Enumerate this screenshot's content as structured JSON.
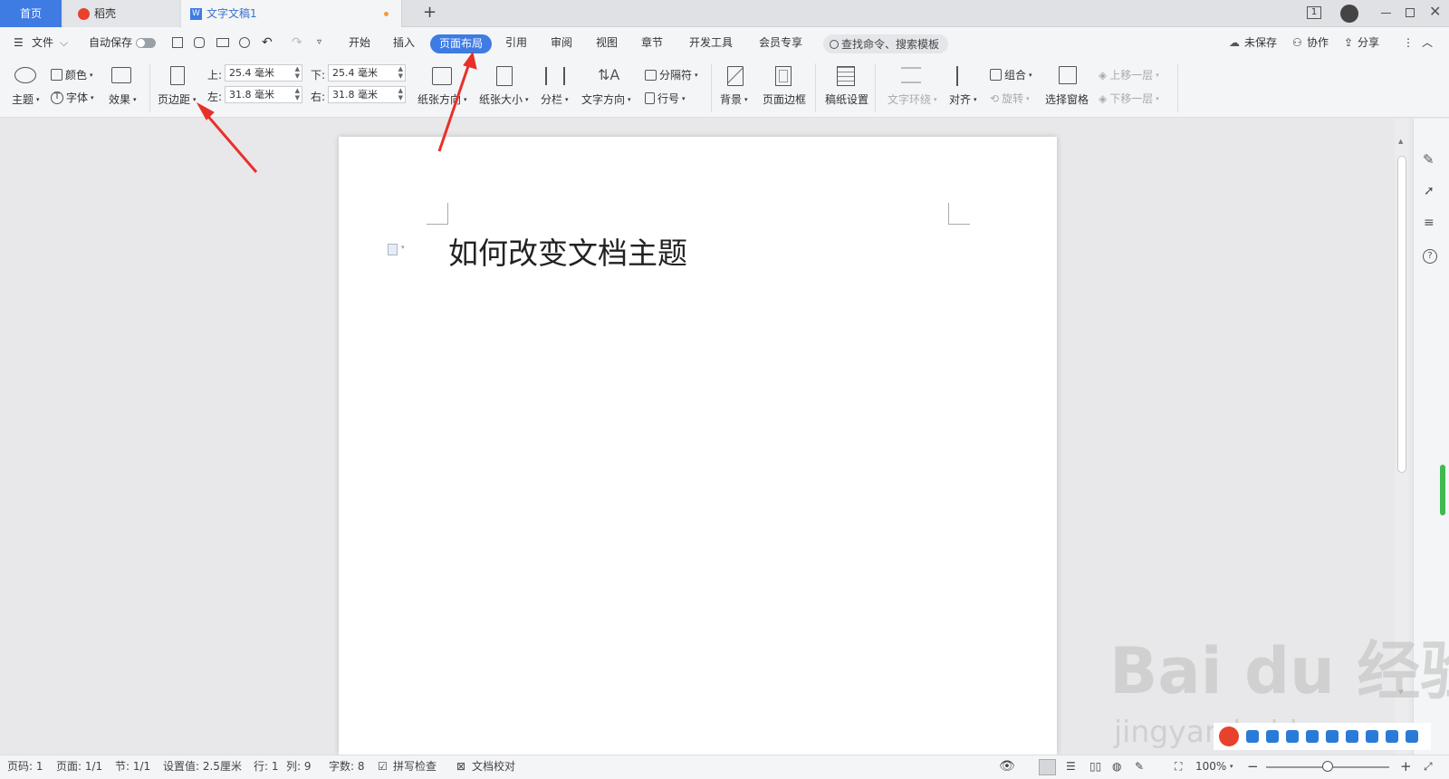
{
  "tabs": {
    "home": "首页",
    "daoke": "稻壳",
    "doc": "文字文稿1",
    "new_tab": "+",
    "window_count": "1"
  },
  "menu": {
    "file": "文件",
    "autosave": "自动保存",
    "items": [
      "开始",
      "插入",
      "页面布局",
      "引用",
      "审阅",
      "视图",
      "章节",
      "开发工具",
      "会员专享"
    ],
    "active": "页面布局",
    "search": "查找命令、搜索模板",
    "unsaved": "未保存",
    "collab": "协作",
    "share": "分享"
  },
  "toolbar": {
    "theme": "主题",
    "color": "颜色",
    "font": "字体",
    "effect": "效果",
    "margins": "页边距",
    "top_label": "上:",
    "top_value": "25.4 毫米",
    "bottom_label": "下:",
    "bottom_value": "25.4 毫米",
    "left_label": "左:",
    "left_value": "31.8 毫米",
    "right_label": "右:",
    "right_value": "31.8 毫米",
    "orientation": "纸张方向",
    "size": "纸张大小",
    "columns": "分栏",
    "text_dir": "文字方向",
    "breaks": "分隔符",
    "line_num": "行号",
    "background": "背景",
    "page_border": "页面边框",
    "grid_setup": "稿纸设置",
    "wrap": "文字环绕",
    "align": "对齐",
    "group": "组合",
    "rotate": "旋转",
    "select_pane": "选择窗格",
    "bring_forward": "上移一层",
    "send_backward": "下移一层"
  },
  "document": {
    "title": "如何改变文档主题"
  },
  "status": {
    "page_num": "页码: 1",
    "pages": "页面: 1/1",
    "section": "节: 1/1",
    "setting": "设置值: 2.5厘米",
    "row": "行: 1",
    "col": "列: 9",
    "word_count": "字数: 8",
    "spell": "拼写检查",
    "proof": "文档校对",
    "zoom": "100%",
    "zoom_level": 0.5
  },
  "watermark": {
    "brand": "Bai du 经验",
    "url": "jingyan.baidu.com"
  },
  "colors": {
    "accent": "#3e7be3",
    "arrow": "#e8302a"
  }
}
